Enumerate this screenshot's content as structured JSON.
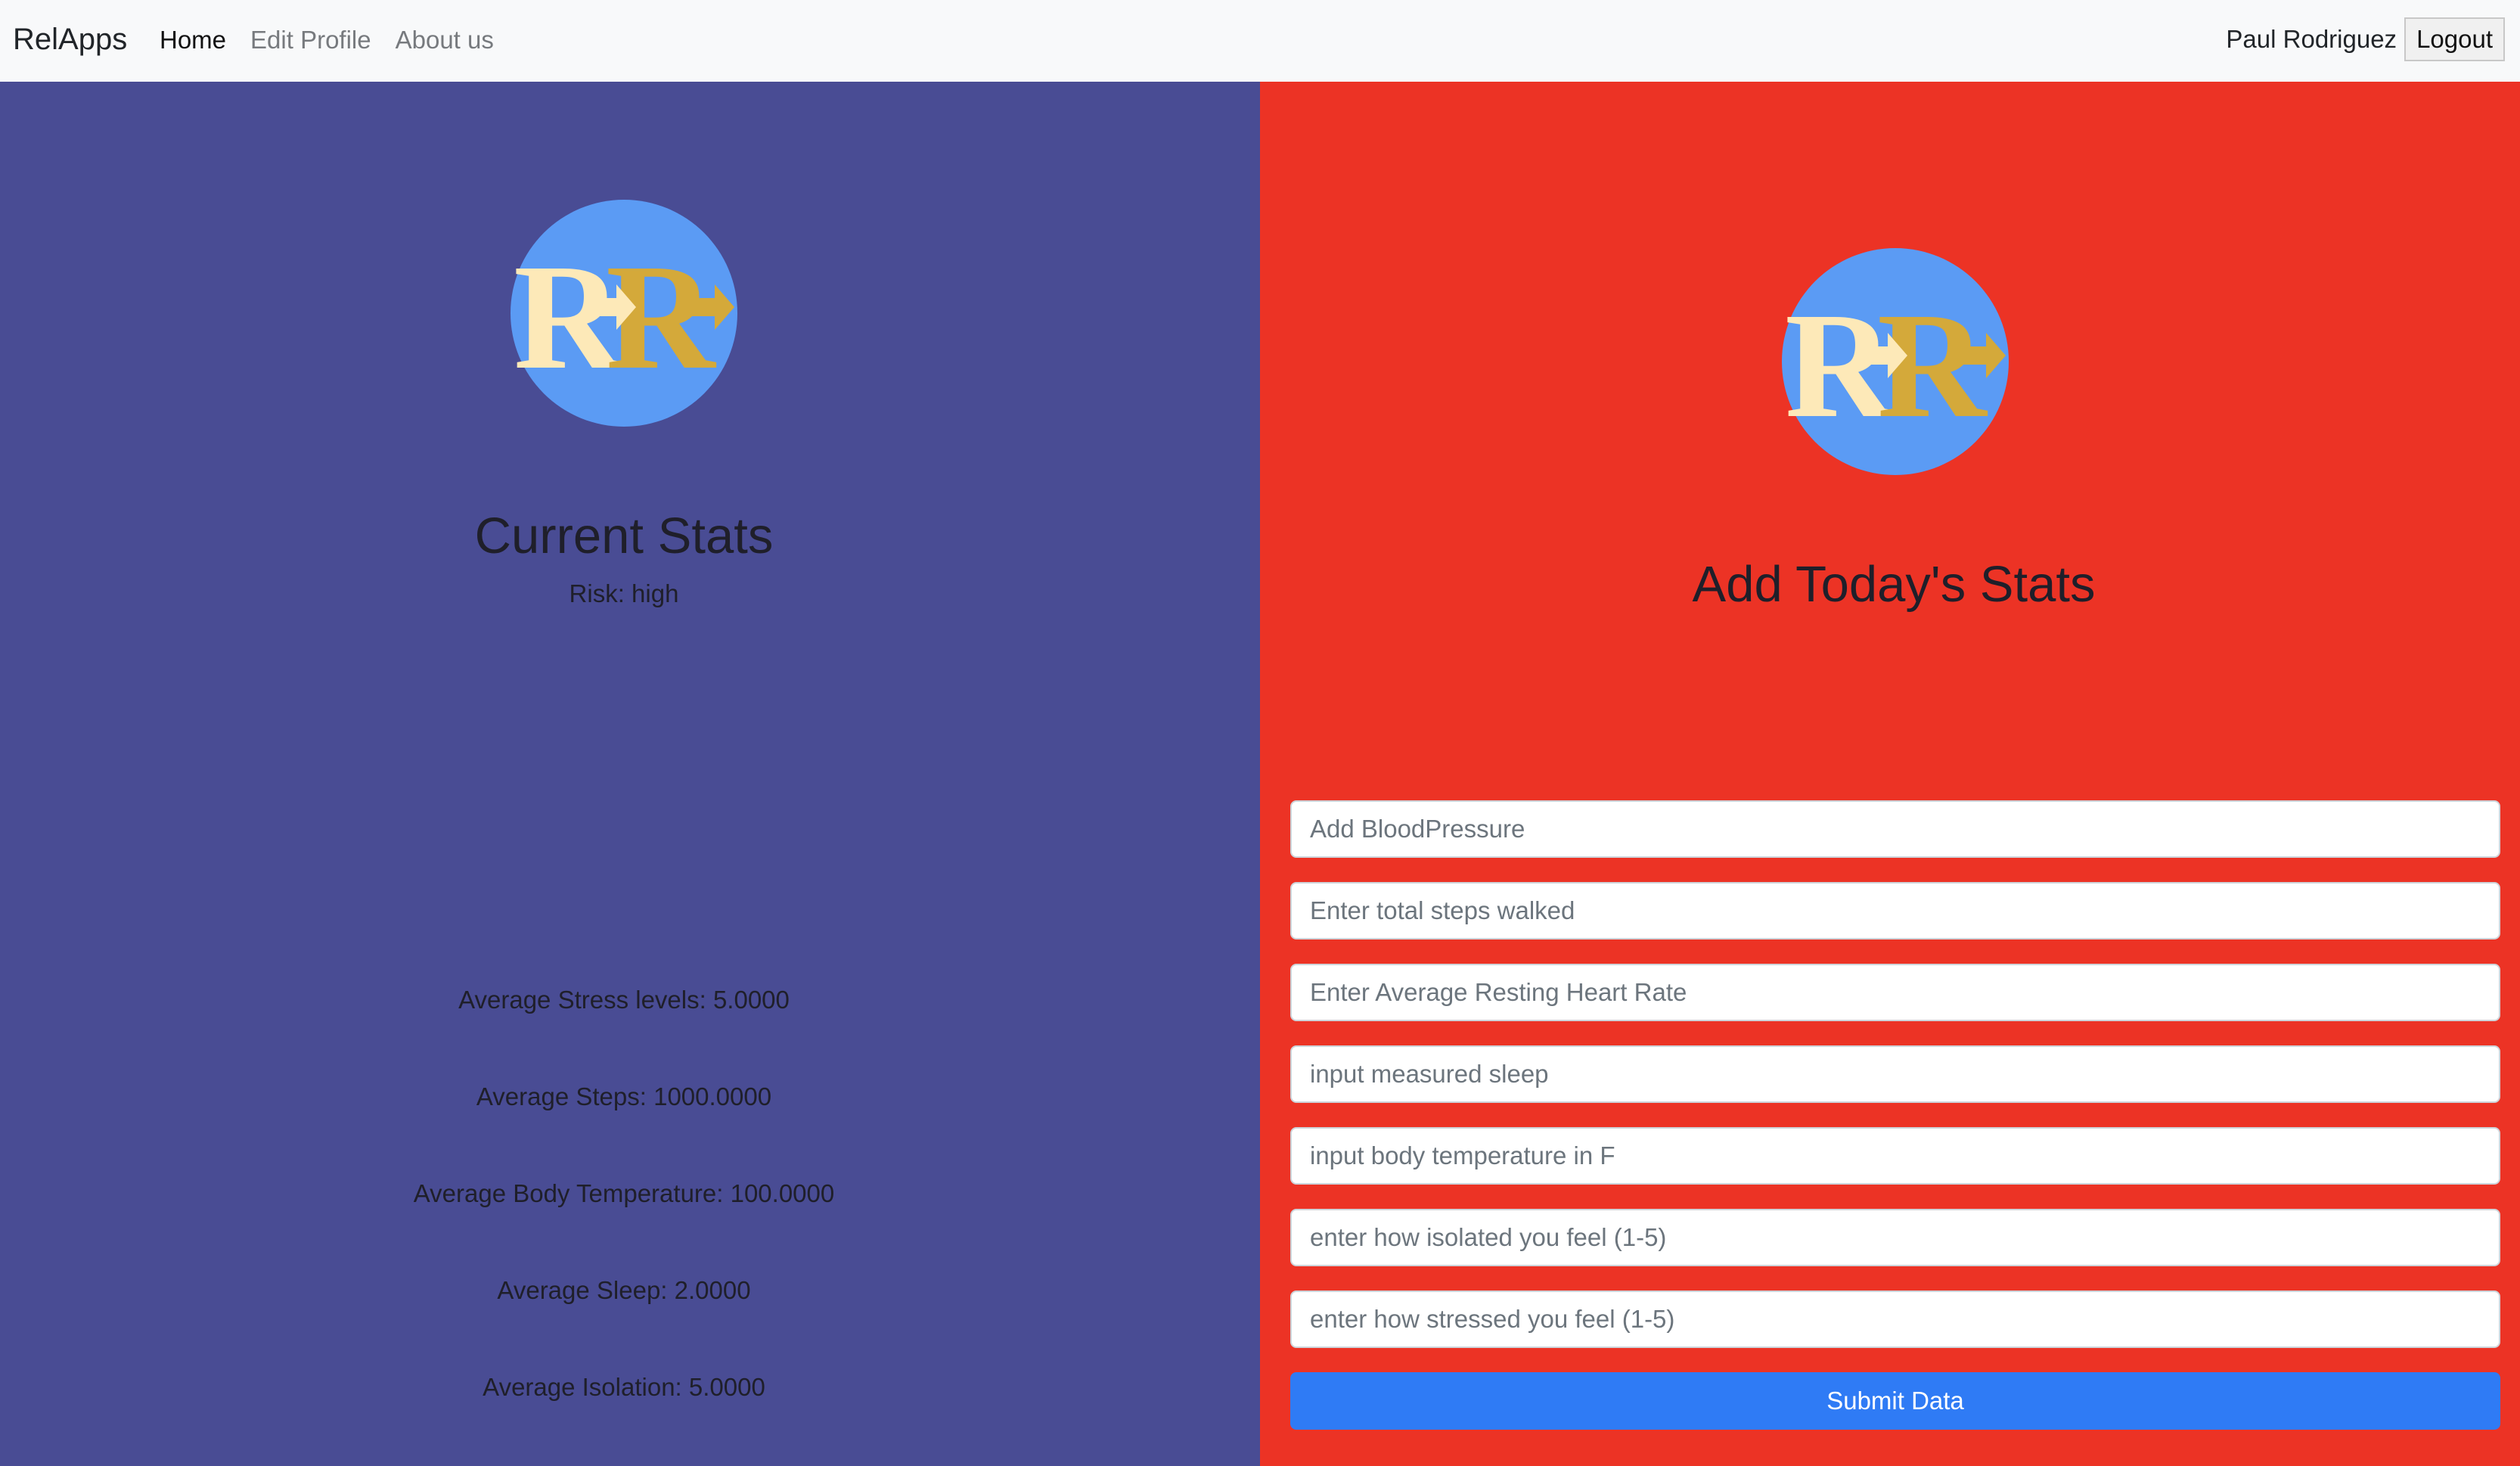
{
  "navbar": {
    "brand": "RelApps",
    "links": [
      {
        "label": "Home",
        "active": true
      },
      {
        "label": "Edit Profile",
        "active": false
      },
      {
        "label": "About us",
        "active": false
      }
    ],
    "user_name": "Paul Rodriguez",
    "logout_label": "Logout"
  },
  "left": {
    "heading": "Current Stats",
    "risk": "Risk: high",
    "stats": [
      "Average Stress levels: 5.0000",
      "Average Steps: 1000.0000",
      "Average Body Temperature: 100.0000",
      "Average Sleep: 2.0000",
      "Average Isolation: 5.0000"
    ]
  },
  "right": {
    "heading": "Add Today's Stats",
    "fields": [
      {
        "placeholder": "Add BloodPressure",
        "value": ""
      },
      {
        "placeholder": "Enter total steps walked",
        "value": ""
      },
      {
        "placeholder": "Enter Average Resting Heart Rate",
        "value": ""
      },
      {
        "placeholder": "input measured sleep",
        "value": ""
      },
      {
        "placeholder": "input body temperature in F",
        "value": ""
      },
      {
        "placeholder": "enter how isolated you feel (1-5)",
        "value": ""
      },
      {
        "placeholder": "enter how stressed you feel (1-5)",
        "value": ""
      }
    ],
    "submit_label": "Submit Data"
  },
  "logo": {
    "icon": "rr-arrow-logo",
    "circle_color": "#5b9bf4",
    "letter_light": "#fde9b8",
    "letter_gold": "#d4a93a"
  },
  "colors": {
    "left_bg": "#494c94",
    "right_bg": "#ec3325",
    "submit_bg": "#2f7bf5"
  }
}
